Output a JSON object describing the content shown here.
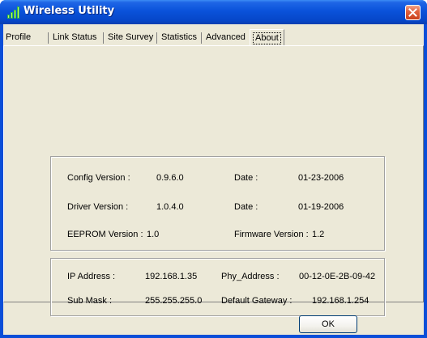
{
  "window": {
    "title": "Wireless Utility",
    "icon": "signal-bars-icon",
    "close_icon": "close-icon"
  },
  "tabs": [
    {
      "label": "Profile",
      "active": false
    },
    {
      "label": "Link Status",
      "active": false
    },
    {
      "label": "Site Survey",
      "active": false
    },
    {
      "label": "Statistics",
      "active": false
    },
    {
      "label": "Advanced",
      "active": false
    },
    {
      "label": "About",
      "active": true
    }
  ],
  "versions": {
    "config_label": "Config Version :",
    "config_value": "0.9.6.0",
    "config_date_label": "Date :",
    "config_date_value": "01-23-2006",
    "driver_label": "Driver Version :",
    "driver_value": "1.0.4.0",
    "driver_date_label": "Date :",
    "driver_date_value": "01-19-2006",
    "eeprom_label": "EEPROM Version :",
    "eeprom_value": "1.0",
    "firmware_label": "Firmware Version :",
    "firmware_value": "1.2"
  },
  "network": {
    "ip_label": "IP Address :",
    "ip_value": "192.168.1.35",
    "phy_label": "Phy_Address :",
    "phy_value": "00-12-0E-2B-09-42",
    "mask_label": "Sub Mask :",
    "mask_value": "255.255.255.0",
    "gateway_label": "Default Gateway :",
    "gateway_value": "192.168.1.254"
  },
  "buttons": {
    "ok_label": "OK"
  },
  "colors": {
    "titlebar": "#0a52da",
    "dialog_bg": "#ece9d8",
    "close_button": "#e2633f"
  }
}
